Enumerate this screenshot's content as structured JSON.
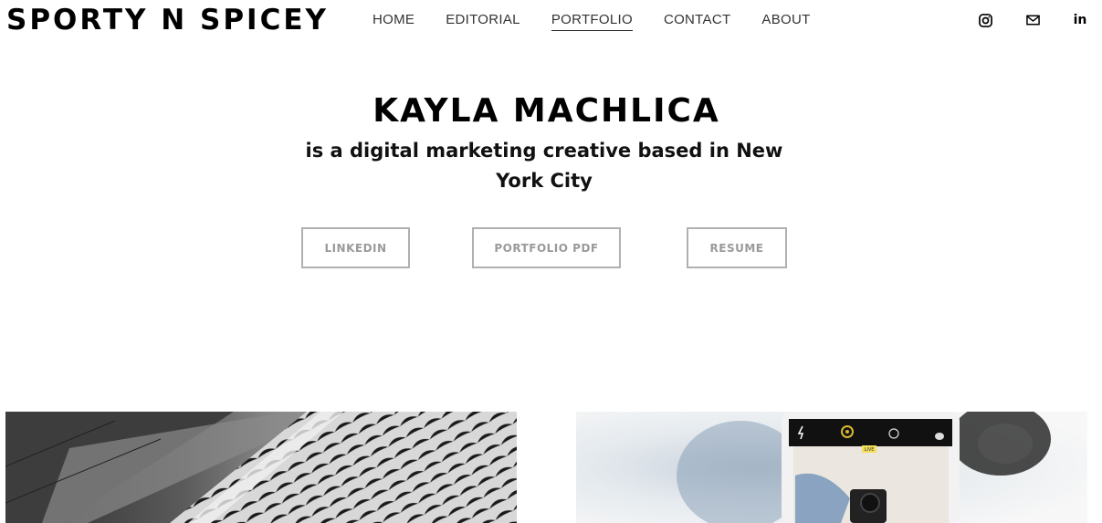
{
  "header": {
    "logo": "SPORTY N SPICEY",
    "nav": [
      {
        "label": "HOME",
        "active": false
      },
      {
        "label": "EDITORIAL",
        "active": false
      },
      {
        "label": "PORTFOLIO",
        "active": true
      },
      {
        "label": "CONTACT",
        "active": false
      },
      {
        "label": "ABOUT",
        "active": false
      }
    ],
    "social": [
      {
        "icon": "instagram-icon"
      },
      {
        "icon": "mail-icon"
      },
      {
        "icon": "linkedin-icon"
      }
    ],
    "linkedin_glyph": "in"
  },
  "hero": {
    "name": "KAYLA MACHLICA",
    "tagline": "is a digital marketing creative based in New York City"
  },
  "buttons": {
    "linkedin": "LINKEDIN",
    "portfolio_pdf": "PORTFOLIO PDF",
    "resume": "RESUME"
  },
  "gallery": {
    "tiles": [
      {
        "icon": "architecture-photo"
      },
      {
        "icon": "phone-camera-photo"
      }
    ],
    "phone_badge": "LIVE"
  },
  "colors": {
    "button_border": "#b0b0b0",
    "button_text": "#9a9a9a",
    "text": "#000000",
    "background": "#ffffff"
  }
}
